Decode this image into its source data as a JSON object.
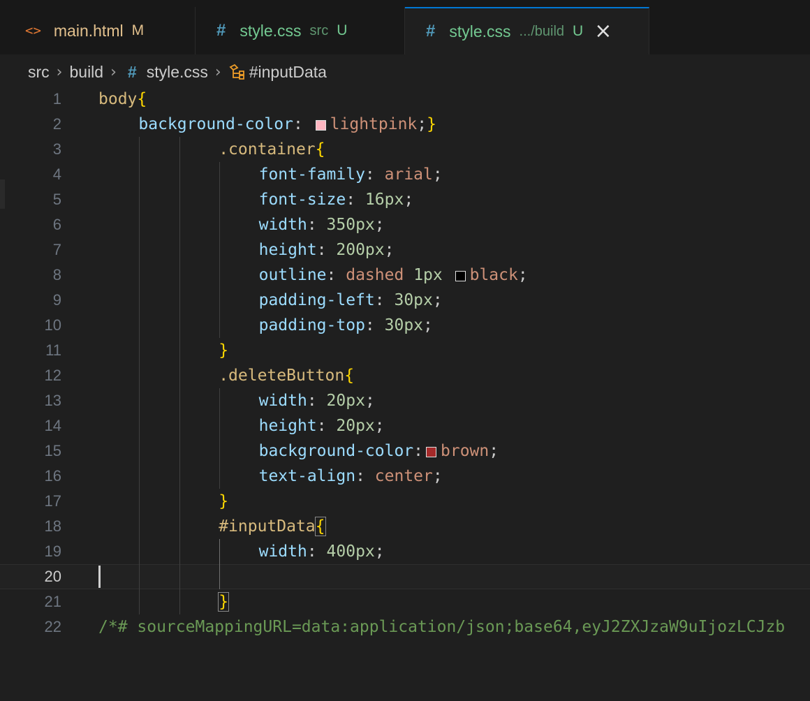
{
  "tabs": [
    {
      "icon": "<>",
      "name": "main.html",
      "status": "M"
    },
    {
      "icon": "#",
      "name": "style.css",
      "description": "src",
      "status": "U"
    },
    {
      "icon": "#",
      "name": "style.css",
      "description": ".../build",
      "status": "U",
      "close": "×"
    }
  ],
  "breadcrumb": {
    "folder1": "src",
    "folder2": "build",
    "file_icon": "#",
    "file": "style.css",
    "symbol": "#inputData"
  },
  "editor": {
    "current_line": 20,
    "colors": {
      "lightpink": "#ffb6c1",
      "black": "#000000",
      "brown": "#a52a2a"
    },
    "lines": [
      {
        "n": "1",
        "tokens": [
          "body",
          "{"
        ]
      },
      {
        "n": "2",
        "tokens": [
          "background-color",
          ": ",
          "lightpink",
          ";",
          "}"
        ]
      },
      {
        "n": "3",
        "tokens": [
          ".container",
          "{"
        ]
      },
      {
        "n": "4",
        "tokens": [
          "font-family",
          ": ",
          "arial",
          ";"
        ]
      },
      {
        "n": "5",
        "tokens": [
          "font-size",
          ": ",
          "16px",
          ";"
        ]
      },
      {
        "n": "6",
        "tokens": [
          "width",
          ": ",
          "350px",
          ";"
        ]
      },
      {
        "n": "7",
        "tokens": [
          "height",
          ": ",
          "200px",
          ";"
        ]
      },
      {
        "n": "8",
        "tokens": [
          "outline",
          ": ",
          "dashed",
          " ",
          "1px",
          " ",
          "black",
          ";"
        ]
      },
      {
        "n": "9",
        "tokens": [
          "padding-left",
          ": ",
          "30px",
          ";"
        ]
      },
      {
        "n": "10",
        "tokens": [
          "padding-top",
          ": ",
          "30px",
          ";"
        ]
      },
      {
        "n": "11",
        "tokens": [
          "}"
        ]
      },
      {
        "n": "12",
        "tokens": [
          ".deleteButton",
          "{"
        ]
      },
      {
        "n": "13",
        "tokens": [
          "width",
          ": ",
          "20px",
          ";"
        ]
      },
      {
        "n": "14",
        "tokens": [
          "height",
          ": ",
          "20px",
          ";"
        ]
      },
      {
        "n": "15",
        "tokens": [
          "background-color",
          ":",
          "brown",
          ";"
        ]
      },
      {
        "n": "16",
        "tokens": [
          "text-align",
          ": ",
          "center",
          ";"
        ]
      },
      {
        "n": "17",
        "tokens": [
          "}"
        ]
      },
      {
        "n": "18",
        "tokens": [
          "#inputData",
          "{"
        ]
      },
      {
        "n": "19",
        "tokens": [
          "width",
          ": ",
          "400px",
          ";"
        ]
      },
      {
        "n": "20",
        "tokens": []
      },
      {
        "n": "21",
        "tokens": [
          "}"
        ]
      },
      {
        "n": "22",
        "tokens": [
          "/*# sourceMappingURL=data:application/json;base64,eyJ2ZXJzaW9uIjozLCJzb"
        ]
      }
    ]
  }
}
